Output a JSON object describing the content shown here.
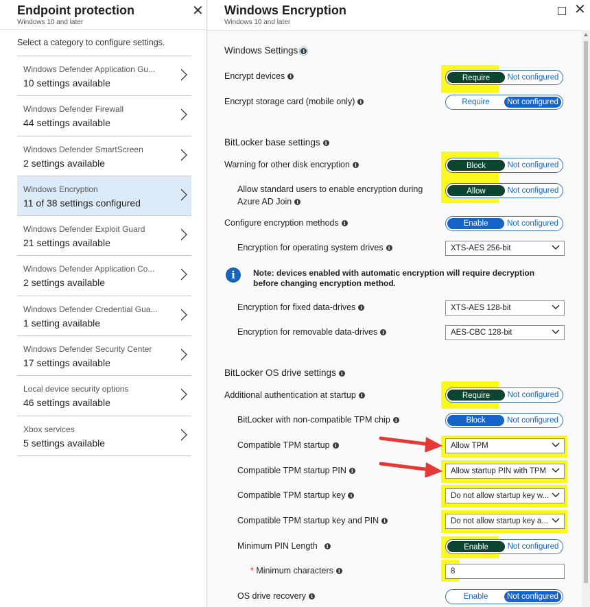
{
  "left": {
    "title": "Endpoint protection",
    "subtitle": "Windows 10 and later",
    "hint": "Select a category to configure settings.",
    "items": [
      {
        "name": "Windows Defender Application Gu...",
        "count": "10 settings available"
      },
      {
        "name": "Windows Defender Firewall",
        "count": "44 settings available"
      },
      {
        "name": "Windows Defender SmartScreen",
        "count": "2 settings available"
      },
      {
        "name": "Windows Encryption",
        "count": "11 of 38 settings configured"
      },
      {
        "name": "Windows Defender Exploit Guard",
        "count": "21 settings available"
      },
      {
        "name": "Windows Defender Application Co...",
        "count": "2 settings available"
      },
      {
        "name": "Windows Defender Credential Gua...",
        "count": "1 setting available"
      },
      {
        "name": "Windows Defender Security Center",
        "count": "17 settings available"
      },
      {
        "name": "Local device security options",
        "count": "46 settings available"
      },
      {
        "name": "Xbox services",
        "count": "5 settings available"
      }
    ]
  },
  "right": {
    "title": "Windows Encryption",
    "subtitle": "Windows 10 and later",
    "sections": {
      "windows": "Windows Settings",
      "bitlocker_base": "BitLocker base settings",
      "bitlocker_os": "BitLocker OS drive settings"
    },
    "settings": {
      "encrypt_devices": {
        "label": "Encrypt devices",
        "on": "Require",
        "off": "Not configured"
      },
      "encrypt_storage": {
        "label": "Encrypt storage card (mobile only)",
        "on": "Require",
        "off": "Not configured"
      },
      "warn_disk": {
        "label": "Warning for other disk encryption",
        "on": "Block",
        "off": "Not configured"
      },
      "allow_std_line1": "Allow standard users to enable encryption during",
      "allow_std_line2": "Azure AD Join",
      "allow_std": {
        "on": "Allow",
        "off": "Not configured"
      },
      "configure_methods": {
        "label": "Configure encryption methods",
        "on": "Enable",
        "off": "Not configured"
      },
      "os_drives": {
        "label": "Encryption for operating system drives",
        "value": "XTS-AES 256-bit"
      },
      "note_line1": "Note: devices enabled with automatic encryption will require decryption",
      "note_line2": "before changing encryption method.",
      "fixed_drives": {
        "label": "Encryption for fixed data-drives",
        "value": "XTS-AES 128-bit"
      },
      "removable_drives": {
        "label": "Encryption for removable data-drives",
        "value": "AES-CBC 128-bit"
      },
      "additional_auth": {
        "label": "Additional authentication at startup",
        "on": "Require",
        "off": "Not configured"
      },
      "non_compat_tpm": {
        "label": "BitLocker with non-compatible TPM chip",
        "on": "Block",
        "off": "Not configured"
      },
      "tpm_startup": {
        "label": "Compatible TPM startup",
        "value": "Allow TPM"
      },
      "tpm_pin": {
        "label": "Compatible TPM startup PIN",
        "value": "Allow startup PIN with TPM"
      },
      "tpm_key": {
        "label": "Compatible TPM startup key",
        "value": "Do not allow startup key w..."
      },
      "tpm_key_pin": {
        "label": "Compatible TPM startup key and PIN",
        "value": "Do not allow startup key a..."
      },
      "min_pin": {
        "label": "Minimum PIN Length",
        "on": "Enable",
        "off": "Not configured"
      },
      "min_chars": {
        "required_mark": "*",
        "label": "Minimum characters",
        "value": "8"
      },
      "os_recovery": {
        "label": "OS drive recovery",
        "on": "Enable",
        "off": "Not configured"
      }
    }
  },
  "colors": {
    "highlight": "#fbf81e",
    "toggle_blue": "#1562c9",
    "toggle_green": "#0b4631",
    "selected_row": "#dcebf8",
    "arrow_red": "#e53935"
  }
}
